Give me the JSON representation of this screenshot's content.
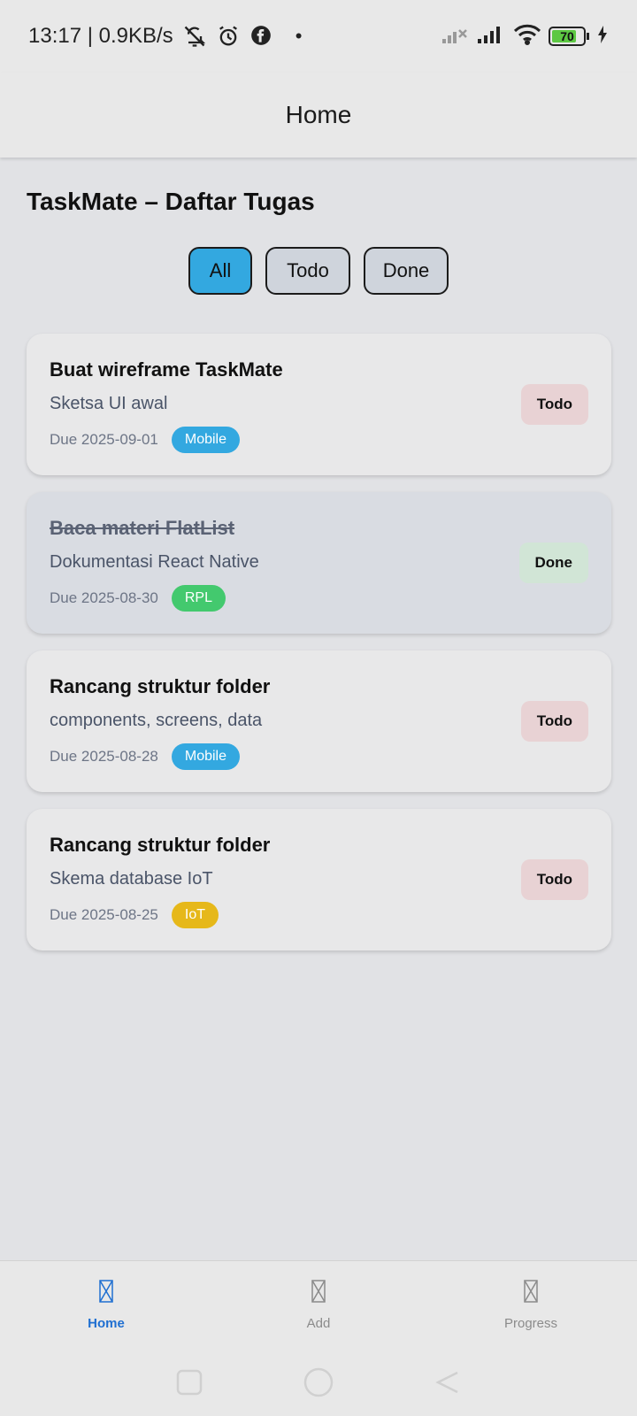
{
  "status_bar": {
    "time_speed": "13:17 | 0.9KB/s",
    "battery_level": "70"
  },
  "header": {
    "title": "Home"
  },
  "page_title": "TaskMate – Daftar Tugas",
  "filters": [
    {
      "label": "All",
      "active": true
    },
    {
      "label": "Todo",
      "active": false
    },
    {
      "label": "Done",
      "active": false
    }
  ],
  "tasks": [
    {
      "title": "Buat wireframe TaskMate",
      "desc": "Sketsa UI awal",
      "due": "Due 2025-09-01",
      "tag": "Mobile",
      "tag_color": "#33a8e0",
      "status": "Todo",
      "status_color": "#e8d2d4",
      "done": false
    },
    {
      "title": "Baca materi FlatList",
      "desc": "Dokumentasi React Native",
      "due": "Due 2025-08-30",
      "tag": "RPL",
      "tag_color": "#43c96e",
      "status": "Done",
      "status_color": "#d1e5d6",
      "done": true
    },
    {
      "title": "Rancang struktur folder",
      "desc": "components, screens, data",
      "due": "Due 2025-08-28",
      "tag": "Mobile",
      "tag_color": "#33a8e0",
      "status": "Todo",
      "status_color": "#e8d2d4",
      "done": false
    },
    {
      "title": "Rancang struktur folder",
      "desc": "Skema database IoT",
      "due": "Due 2025-08-25",
      "tag": "IoT",
      "tag_color": "#e6b81a",
      "status": "Todo",
      "status_color": "#e8d2d4",
      "done": false
    }
  ],
  "bottom_nav": [
    {
      "label": "Home",
      "icon": "placeholder-glyph-icon",
      "active": true
    },
    {
      "label": "Add",
      "icon": "placeholder-glyph-icon",
      "active": false
    },
    {
      "label": "Progress",
      "icon": "placeholder-glyph-icon",
      "active": false
    }
  ],
  "colors": {
    "accent": "#1f6fd1",
    "filter_active": "#33a8e0"
  }
}
